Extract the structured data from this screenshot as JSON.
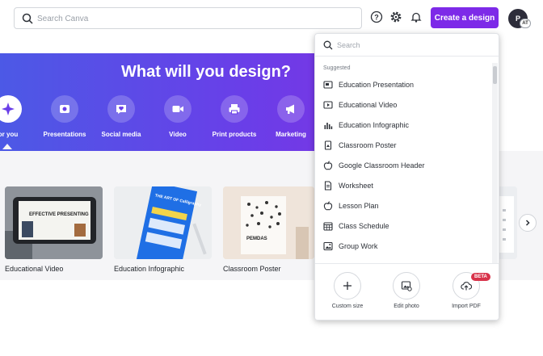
{
  "header": {
    "search_placeholder": "Search Canva",
    "create_button": "Create a design",
    "avatar_initials": "P",
    "avatar_badge": "AT"
  },
  "banner": {
    "title": "What will you design?",
    "size_button": "size",
    "categories": [
      {
        "label": "or you",
        "icon": "sparkle-icon",
        "active": true
      },
      {
        "label": "Presentations",
        "icon": "presentation-icon"
      },
      {
        "label": "Social media",
        "icon": "heart-chat-icon"
      },
      {
        "label": "Video",
        "icon": "video-camera-icon"
      },
      {
        "label": "Print products",
        "icon": "printer-icon"
      },
      {
        "label": "Marketing",
        "icon": "megaphone-icon"
      }
    ]
  },
  "cards": [
    {
      "label": "Educational Video",
      "text": "EFFECTIVE PRESENTING"
    },
    {
      "label": "Education Infographic",
      "text": "THE ART OF Calligraphy"
    },
    {
      "label": "Classroom Poster",
      "text": "PEMDAS"
    }
  ],
  "dropdown": {
    "search_placeholder": "Search",
    "section_label": "Suggested",
    "items": [
      {
        "label": "Education Presentation",
        "icon": "presentation-icon"
      },
      {
        "label": "Educational Video",
        "icon": "video-icon"
      },
      {
        "label": "Education Infographic",
        "icon": "bar-chart-icon"
      },
      {
        "label": "Classroom Poster",
        "icon": "poster-icon"
      },
      {
        "label": "Google Classroom Header",
        "icon": "apple-icon"
      },
      {
        "label": "Worksheet",
        "icon": "document-icon"
      },
      {
        "label": "Lesson Plan",
        "icon": "apple-icon"
      },
      {
        "label": "Class Schedule",
        "icon": "calendar-icon"
      },
      {
        "label": "Group Work",
        "icon": "image-icon"
      }
    ],
    "footer": [
      {
        "label": "Custom size",
        "icon": "plus-icon"
      },
      {
        "label": "Edit photo",
        "icon": "edit-photo-icon"
      },
      {
        "label": "Import PDF",
        "icon": "upload-cloud-icon"
      }
    ],
    "beta_badge": "BETA"
  },
  "colors": {
    "accent": "#7d2ae8",
    "banner_start": "#4c59e6",
    "banner_end": "#8b2be0",
    "beta": "#d8334a"
  }
}
